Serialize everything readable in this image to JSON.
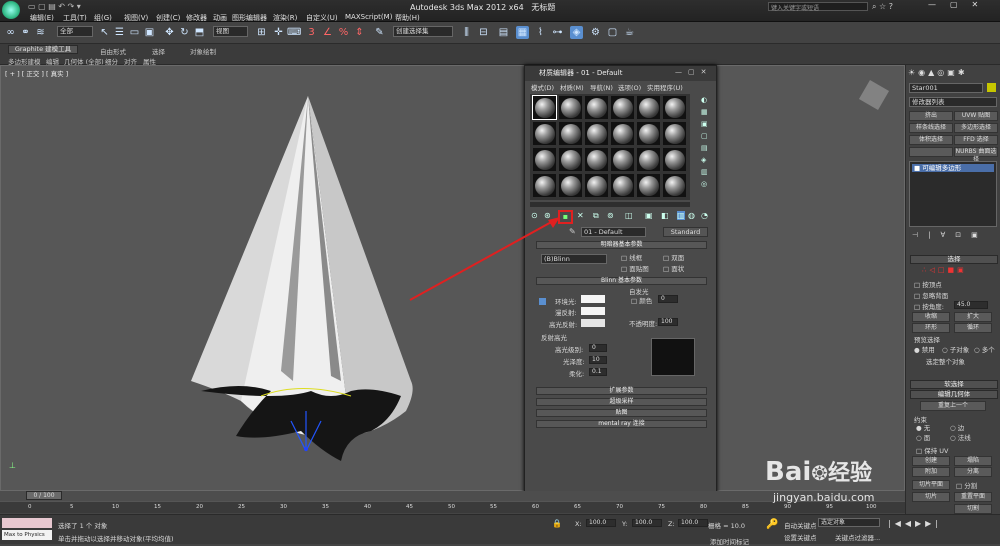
{
  "app": {
    "title": "Autodesk 3ds Max  2012 x64",
    "doc": "无标题",
    "search_placeholder": "键入关键字或短语"
  },
  "menu": [
    "编辑(E)",
    "工具(T)",
    "组(G)",
    "视图(V)",
    "创建(C)",
    "修改器",
    "动画",
    "图形编辑器",
    "渲染(R)",
    "自定义(U)",
    "MAXScript(M)",
    "帮助(H)"
  ],
  "toolbar": {
    "filter": "全部",
    "ref_coord": "视图",
    "selection_set": "创建选择集"
  },
  "ribbon": {
    "tabs": [
      "Graphite 建模工具",
      "自由形式",
      "选择",
      "对象绘制"
    ],
    "subtabs": [
      "多边形建模",
      "编辑",
      "几何体 (全部)",
      "细分",
      "对齐",
      "属性"
    ]
  },
  "viewport": {
    "label": "[ + ] [ 正交 ] [ 真实 ]"
  },
  "material_editor": {
    "title": "材质编辑器 - 01 - Default",
    "menu": [
      "模式(D)",
      "材质(M)",
      "导航(N)",
      "选项(O)",
      "实用程序(U)"
    ],
    "material_name": "01 - Default",
    "type_button": "Standard",
    "shader_rollout": "明暗器基本参数",
    "shader": "(B)Blinn",
    "shader_opts": [
      "线框",
      "双面",
      "面贴图",
      "面状"
    ],
    "blinn_rollout": "Blinn 基本参数",
    "self_illum": "自发光",
    "color_label": "颜色",
    "color_val": "0",
    "ambient": "环境光:",
    "diffuse": "漫反射:",
    "specular": "高光反射:",
    "opacity_label": "不透明度:",
    "opacity_val": "100",
    "spec_highlights": "反射高光",
    "spec_level": "高光级别:",
    "spec_level_val": "0",
    "gloss": "光泽度:",
    "gloss_val": "10",
    "soften": "柔化:",
    "soften_val": "0.1",
    "rollouts": [
      "扩展参数",
      "超级采样",
      "贴图",
      "mental ray 连接"
    ]
  },
  "command_panel": {
    "object_name": "Star001",
    "modifier_list": "修改器列表",
    "mod_buttons": [
      "挤出",
      "UVW 贴图",
      "样条线选择",
      "多边形选择",
      "体积选择",
      "FFD 选择",
      "",
      "NURBS 曲面选择"
    ],
    "stack_item": "可编辑多边形",
    "select_rollout": "选择",
    "by_vertex": "按顶点",
    "ignore_back": "忽略背面",
    "angle_label": "按角度:",
    "angle_val": "45.0",
    "shrink": "收缩",
    "grow": "扩大",
    "ring": "环形",
    "loop": "循环",
    "preview": "预览选择",
    "off": "禁用",
    "subobj": "子对象",
    "multi": "多个",
    "select_whole": "选定整个对象",
    "soft_sel": "软选择",
    "edit_geo": "编辑几何体",
    "repeat_last": "重复上一个",
    "constraints": "约束",
    "c_none": "无",
    "c_edge": "边",
    "c_face": "面",
    "c_normal": "法线",
    "keep_uv": "保持 UV",
    "create": "创建",
    "collapse": "塌陷",
    "attach": "附加",
    "detach": "分离",
    "slice_plane": "切片平面",
    "split": "分割",
    "slice": "切片",
    "reset_plane": "重置平面",
    "cut": "切割"
  },
  "timeline": {
    "frame": "0 / 100",
    "ticks": [
      "0",
      "5",
      "10",
      "15",
      "20",
      "25",
      "30",
      "35",
      "40",
      "45",
      "50",
      "55",
      "60",
      "65",
      "70",
      "75",
      "80",
      "85",
      "90",
      "95",
      "100"
    ]
  },
  "status": {
    "maxscript": "Max to Physics",
    "line1": "选择了 1 个 对象",
    "line2": "单击并拖动以选择并移动对象(平均均值)",
    "x": "100.0",
    "y": "100.0",
    "z": "100.0",
    "grid": "栅格 = 10.0",
    "autokey": "自动关键点",
    "setkey": "设置关键点",
    "selected": "选定对象",
    "keyfilters": "关键点过滤器...",
    "addtime": "添加时间标记"
  },
  "watermark": {
    "brand": "Bai",
    "brand2": "经验",
    "url": "jingyan.baidu.com"
  }
}
